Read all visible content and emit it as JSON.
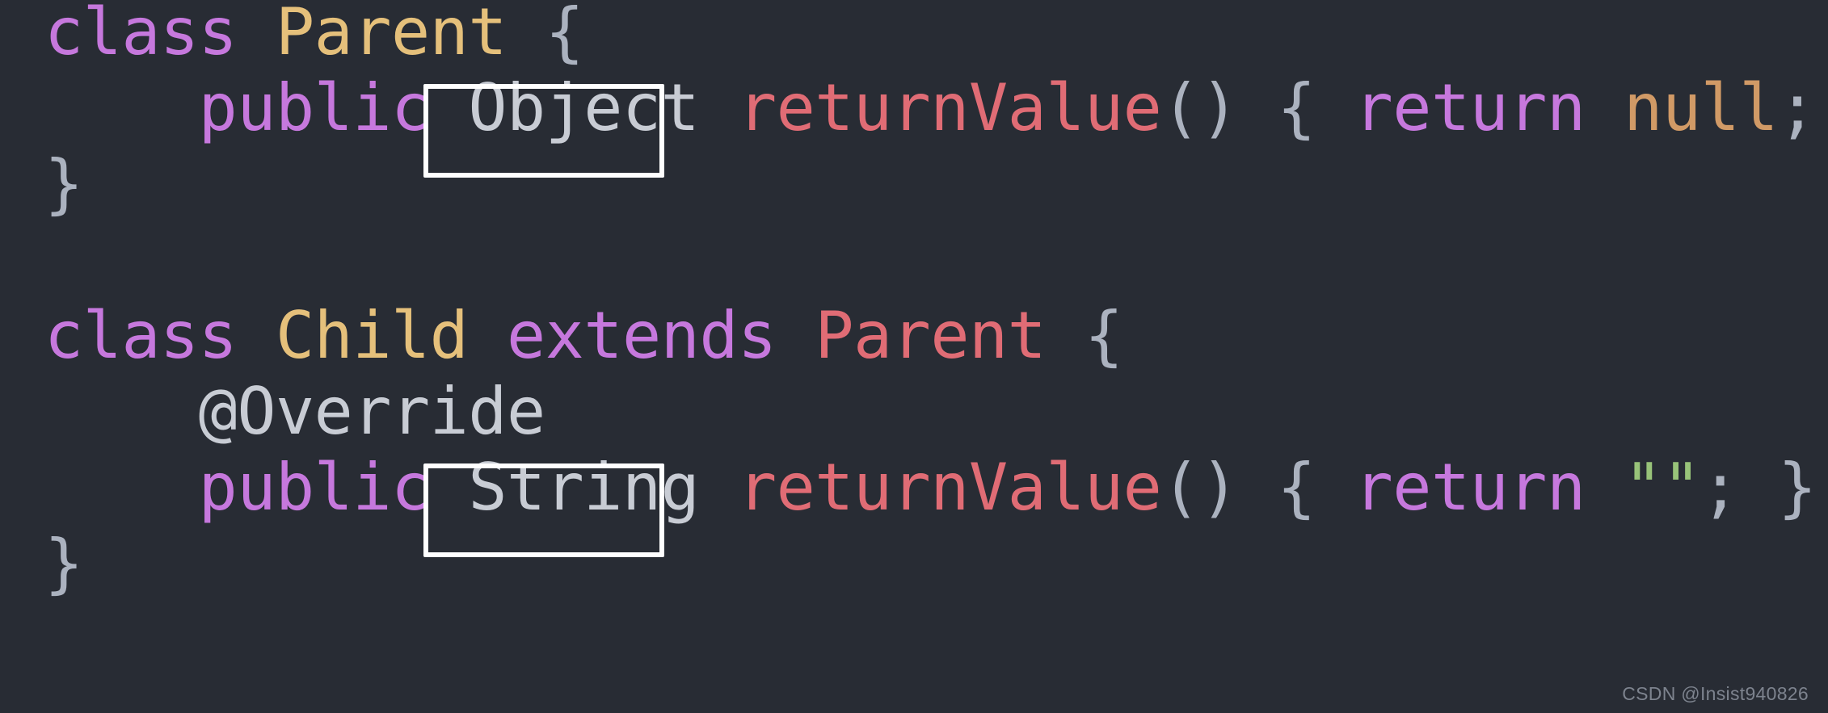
{
  "editor": {
    "background_color": "#282c34",
    "language": "java",
    "font_style": "monospace"
  },
  "palette": {
    "keyword": "#c678dd",
    "class_declaration": "#e5c07b",
    "type_reference": "#e06c75",
    "method_name": "#e06c75",
    "punctuation": "#abb2bf",
    "null_literal": "#d19a66",
    "string_literal": "#98c379",
    "annotation": "#c8ccd4",
    "highlight_border": "#ffffff",
    "watermark": "#7d838e"
  },
  "code": {
    "line1": {
      "keyword_class": "class",
      "space1": " ",
      "class_name": "Parent",
      "space2": " ",
      "brace_open": "{"
    },
    "line2": {
      "indent": "    ",
      "modifier": "public",
      "space1": " ",
      "return_type": "Object",
      "space2": " ",
      "method_name": "returnValue",
      "parens": "()",
      "space3": " ",
      "brace_open": "{",
      "space4": " ",
      "keyword_return": "return",
      "space5": " ",
      "value": "null",
      "semicolon": ";",
      "space6": " ",
      "brace_close": "}"
    },
    "line3": {
      "brace_close": "}"
    },
    "line4": {
      "blank": " "
    },
    "line5": {
      "keyword_class": "class",
      "space1": " ",
      "class_name": "Child",
      "space2": " ",
      "keyword_extends": "extends",
      "space3": " ",
      "super_class": "Parent",
      "space4": " ",
      "brace_open": "{"
    },
    "line6": {
      "indent": "    ",
      "annotation": "@Override"
    },
    "line7": {
      "indent": "    ",
      "modifier": "public",
      "space1": " ",
      "return_type": "String",
      "space2": " ",
      "method_name": "returnValue",
      "parens": "()",
      "space3": " ",
      "brace_open": "{",
      "space4": " ",
      "keyword_return": "return",
      "space5": " ",
      "value": "\"\"",
      "semicolon": ";",
      "space6": " ",
      "brace_close": "}"
    },
    "line8": {
      "brace_close": "}"
    }
  },
  "annotations": {
    "highlight_1_target": "Object",
    "highlight_2_target": "String"
  },
  "watermark": {
    "text": "CSDN @Insist940826"
  }
}
